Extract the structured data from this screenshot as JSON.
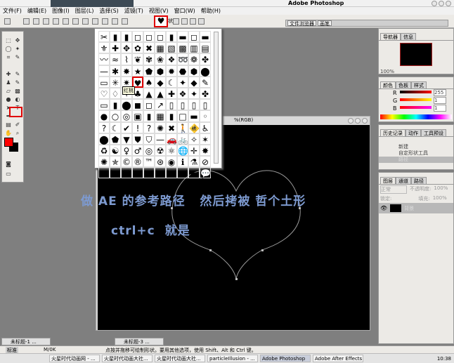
{
  "app": {
    "title": "Adobe Photoshop"
  },
  "menu": [
    "文件(F)",
    "编辑(E)",
    "图像(I)",
    "图层(L)",
    "选择(S)",
    "滤镜(T)",
    "视图(V)",
    "窗口(W)",
    "帮助(H)"
  ],
  "options": {
    "shape_label": "形状:",
    "shape_value": "♥"
  },
  "palette_well": [
    "文件浏览器",
    "画笔"
  ],
  "picker": {
    "glyphs": [
      "✂",
      "▮",
      "▮",
      "◻",
      "◻",
      "◻",
      "▮",
      "▬",
      "◻",
      "▬",
      "⚜",
      "✚",
      "✥",
      "✿",
      "✖",
      "▦",
      "▧",
      "▩",
      "▥",
      "▤",
      "〰",
      "≈",
      "⌇",
      "❦",
      "✾",
      "❀",
      "❖",
      "➿",
      "❁",
      "✤",
      "—",
      "✱",
      "✸",
      "★",
      "⬟",
      "⬢",
      "✹",
      "⬣",
      "⬢",
      "⬤",
      "▭",
      "✳",
      "✷",
      "♥",
      "♠",
      "◆",
      "☾",
      "✦",
      "◆",
      "✎",
      "♡",
      "♢",
      "⚘",
      "♣",
      "▲",
      "▲",
      "✚",
      "❖",
      "✦",
      "✤",
      "▭",
      "▮",
      "⬤",
      "◼",
      "◻",
      "↗",
      "▯",
      "▯",
      "▯",
      "▯",
      "●",
      "○",
      "◎",
      "▣",
      "▮",
      "▦",
      "▮",
      "□",
      "▬",
      "◦",
      "?",
      "☾",
      "✔",
      "!",
      "?",
      "✺",
      "✖",
      "🚶",
      "🚸",
      "♿",
      "⬤",
      "⬟",
      "▼",
      "⛊",
      "⛉",
      "—",
      "🚗",
      "🚲",
      "✧",
      "✶",
      "♻",
      "☯",
      "♀",
      "♂",
      "◎",
      "☢",
      "⚛",
      "🌐",
      "✛",
      "✸",
      "✺",
      "✯",
      "©",
      "®",
      "™",
      "⊛",
      "◉",
      "ℹ",
      "⚗",
      "⊘",
      "➤",
      "➢",
      "☑",
      "▢",
      "⬬",
      "⬬",
      "⬬",
      "▬",
      "▬",
      "💬"
    ],
    "selected_index": 43,
    "tooltip": "红桃"
  },
  "document": {
    "title": "%(RGB)"
  },
  "caption": {
    "line1": "做 AE 的参考路径   然后拷被 哲个土形",
    "line2": "ctrl+c  就是"
  },
  "navigator": {
    "tabs": [
      "导航器",
      "信息"
    ],
    "zoom": "100%"
  },
  "color": {
    "tabs": [
      "颜色",
      "色板",
      "样式"
    ],
    "r_label": "R",
    "g_label": "G",
    "b_label": "B",
    "r": "255",
    "g": "1",
    "b": "1"
  },
  "history": {
    "tabs": [
      "历史记录",
      "动作",
      "工具预设"
    ],
    "items": [
      "新建",
      "自定形状工具",
      "路径"
    ]
  },
  "layers": {
    "tabs": [
      "图层",
      "通道",
      "路径"
    ],
    "blend": "正常",
    "opacity_label": "不透明度:",
    "opacity": "100%",
    "lock_label": "锁定:",
    "fill_label": "填充:",
    "fill": "100%",
    "layer_name": "背景"
  },
  "minimized_docs": [
    "未标题-1 ...",
    "未标题-3 ..."
  ],
  "status": {
    "zoom": "标准",
    "doc": "M/0K",
    "hint": "点按并拖移可绘制形状。要用其他选项，使用 Shift、Alt 和 Ctrl 键。"
  },
  "taskbar": {
    "tasks": [
      "火星时代动画网 - ...",
      "火星时代动画大社...",
      "火星时代动画大社...",
      "particleIllusion - ...",
      "Adobe Photoshop",
      "Adobe After Effects"
    ],
    "active_index": 4,
    "clock": "10:38"
  },
  "colors": {
    "accent": "#e00000",
    "caption": "#7d9ad0"
  }
}
